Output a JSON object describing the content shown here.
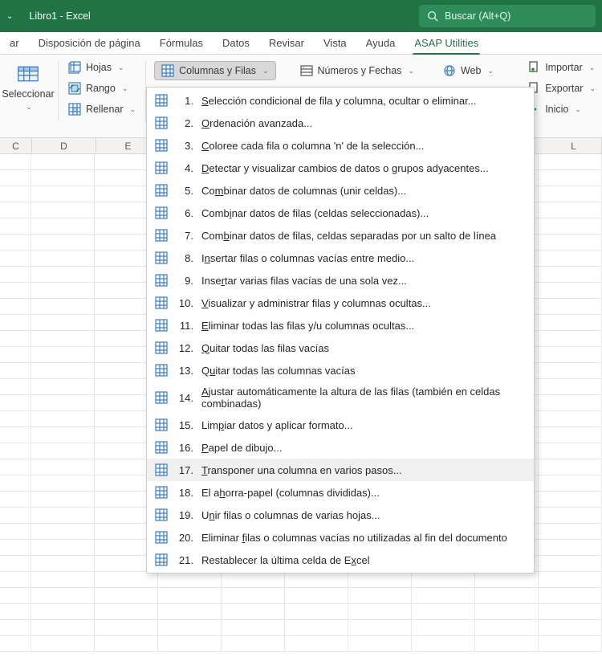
{
  "title": "Libro1 - Excel",
  "search_placeholder": "Buscar (Alt+Q)",
  "tabs": {
    "ar": "ar",
    "disposicion": "Disposición de página",
    "formulas": "Fórmulas",
    "datos": "Datos",
    "revisar": "Revisar",
    "vista": "Vista",
    "ayuda": "Ayuda",
    "asap": "ASAP Utilities"
  },
  "ribbon": {
    "seleccionar": "Seleccionar",
    "hojas": "Hojas",
    "rango": "Rango",
    "rellenar": "Rellenar",
    "columnas_filas": "Columnas y Filas",
    "numeros_fechas": "Números y Fechas",
    "web": "Web",
    "importar": "Importar",
    "exportar": "Exportar",
    "inicio": "Inicio"
  },
  "columns": [
    "C",
    "D",
    "E",
    "",
    "",
    "",
    "",
    "",
    "L"
  ],
  "menu": [
    {
      "n": "1.",
      "txt": "Selección condicional de fila y columna, ocultar o eliminar...",
      "u": 0
    },
    {
      "n": "2.",
      "txt": "Ordenación avanzada...",
      "u": 0
    },
    {
      "n": "3.",
      "txt": "Coloree cada fila o columna 'n' de la selección...",
      "u": 0
    },
    {
      "n": "4.",
      "txt": "Detectar y visualizar cambios de datos o grupos adyacentes...",
      "u": 0
    },
    {
      "n": "5.",
      "txt": "Combinar datos de columnas (unir celdas)...",
      "u": 2
    },
    {
      "n": "6.",
      "txt": "Combinar datos de filas (celdas seleccionadas)...",
      "u": 4
    },
    {
      "n": "7.",
      "txt": "Combinar datos de filas, celdas separadas por un salto de línea",
      "u": 3
    },
    {
      "n": "8.",
      "txt": "Insertar filas o columnas vacías entre medio...",
      "u": 1
    },
    {
      "n": "9.",
      "txt": "Insertar varias filas vacías de una sola vez...",
      "u": 4
    },
    {
      "n": "10.",
      "txt": "Visualizar y administrar filas y columnas ocultas...",
      "u": 0
    },
    {
      "n": "11.",
      "txt": "Eliminar todas las filas y/u columnas ocultas...",
      "u": 0
    },
    {
      "n": "12.",
      "txt": "Quitar todas las filas vacías",
      "u": 0
    },
    {
      "n": "13.",
      "txt": "Quitar todas las columnas vacías",
      "u": 1
    },
    {
      "n": "14.",
      "txt": "Ajustar automáticamente la altura de las filas (también en celdas combinadas)",
      "u": 0
    },
    {
      "n": "15.",
      "txt": "Limpiar datos y aplicar formato...",
      "u": 3
    },
    {
      "n": "16.",
      "txt": "Papel de dibujo...",
      "u": 0
    },
    {
      "n": "17.",
      "txt": "Transponer una columna en varios pasos...",
      "u": 0
    },
    {
      "n": "18.",
      "txt": "El ahorra-papel (columnas divididas)...",
      "u": 4
    },
    {
      "n": "19.",
      "txt": "Unir filas o columnas de varias hojas...",
      "u": 1
    },
    {
      "n": "20.",
      "txt": "Eliminar filas o columnas vacías no utilizadas al fin del documento",
      "u": 9
    },
    {
      "n": "21.",
      "txt": "Restablecer la última celda de Excel",
      "u": 32
    }
  ],
  "hover_index": 16
}
